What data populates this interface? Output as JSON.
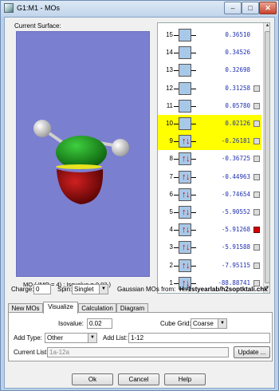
{
  "window": {
    "title": "G1:M1 - MOs",
    "min_glyph": "–",
    "max_glyph": "□",
    "close_glyph": "✕"
  },
  "viewer": {
    "surface_label": "Current Surface:",
    "status": "MO ( IMO = 4) ; Isovalue = 0.02 )"
  },
  "orbitals": [
    {
      "num": "15",
      "energy": "0.36510",
      "occupied": false,
      "highlight": false,
      "checkbox": false,
      "checked": false
    },
    {
      "num": "14",
      "energy": "0.34526",
      "occupied": false,
      "highlight": false,
      "checkbox": false,
      "checked": false
    },
    {
      "num": "13",
      "energy": "0.32698",
      "occupied": false,
      "highlight": false,
      "checkbox": false,
      "checked": false
    },
    {
      "num": "12",
      "energy": "0.31258",
      "occupied": false,
      "highlight": false,
      "checkbox": true,
      "checked": false
    },
    {
      "num": "11",
      "energy": "0.05780",
      "occupied": false,
      "highlight": false,
      "checkbox": true,
      "checked": false
    },
    {
      "num": "10",
      "energy": "0.02126",
      "occupied": false,
      "highlight": true,
      "checkbox": true,
      "checked": false
    },
    {
      "num": "9",
      "energy": "-0.26181",
      "occupied": true,
      "highlight": true,
      "checkbox": true,
      "checked": false
    },
    {
      "num": "8",
      "energy": "-0.36725",
      "occupied": true,
      "highlight": false,
      "checkbox": true,
      "checked": false
    },
    {
      "num": "7",
      "energy": "-0.44963",
      "occupied": true,
      "highlight": false,
      "checkbox": true,
      "checked": false
    },
    {
      "num": "6",
      "energy": "-0.74654",
      "occupied": true,
      "highlight": false,
      "checkbox": true,
      "checked": false
    },
    {
      "num": "5",
      "energy": "-5.90552",
      "occupied": true,
      "highlight": false,
      "checkbox": true,
      "checked": false
    },
    {
      "num": "4",
      "energy": "-5.91268",
      "occupied": true,
      "highlight": false,
      "checkbox": true,
      "checked": true
    },
    {
      "num": "3",
      "energy": "-5.91588",
      "occupied": true,
      "highlight": false,
      "checkbox": true,
      "checked": false
    },
    {
      "num": "2",
      "energy": "-7.95115",
      "occupied": true,
      "highlight": false,
      "checkbox": true,
      "checked": false
    },
    {
      "num": "1",
      "energy": "-88.88741",
      "occupied": true,
      "highlight": false,
      "checkbox": true,
      "checked": false
    }
  ],
  "charge": {
    "label": "Charge:",
    "value": "0",
    "spin_label": "Spin:",
    "spin_value": "Singlet",
    "source_label": "Gaussian MOs from:",
    "source_path": "H:/1styearlab/h2soptktali.chk"
  },
  "tabs": [
    {
      "label": "New MOs",
      "active": false
    },
    {
      "label": "Visualize",
      "active": true
    },
    {
      "label": "Calculation",
      "active": false
    },
    {
      "label": "Diagram",
      "active": false
    }
  ],
  "visualize": {
    "isovalue_label": "Isovalue:",
    "isovalue": "0.02",
    "cube_grid_label": "Cube Grid:",
    "cube_grid": "Coarse",
    "add_type_label": "Add Type:",
    "add_type": "Other",
    "add_list_label": "Add List:",
    "add_list": "1-12",
    "current_list_label": "Current List:",
    "current_list": "1a-12a",
    "update_label": "Update ..."
  },
  "footer": {
    "ok_label": "Ok",
    "cancel_label": "Cancel",
    "help_label": "Help"
  },
  "colors": {
    "viewport_bg": "#7b7fd0",
    "highlight": "#ffff00",
    "energy_text": "#1e2fb0",
    "spin_arrow": "#d40000",
    "lobe_green": "#1a9a1a",
    "lobe_red": "#9a0a0a"
  }
}
